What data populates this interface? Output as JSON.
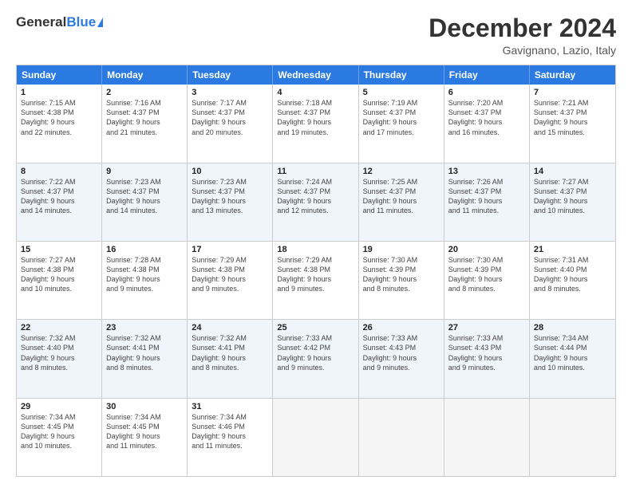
{
  "logo": {
    "general": "General",
    "blue": "Blue"
  },
  "header": {
    "month": "December 2024",
    "location": "Gavignano, Lazio, Italy"
  },
  "days": [
    "Sunday",
    "Monday",
    "Tuesday",
    "Wednesday",
    "Thursday",
    "Friday",
    "Saturday"
  ],
  "rows": [
    [
      {
        "day": "1",
        "lines": [
          "Sunrise: 7:15 AM",
          "Sunset: 4:38 PM",
          "Daylight: 9 hours",
          "and 22 minutes."
        ]
      },
      {
        "day": "2",
        "lines": [
          "Sunrise: 7:16 AM",
          "Sunset: 4:37 PM",
          "Daylight: 9 hours",
          "and 21 minutes."
        ]
      },
      {
        "day": "3",
        "lines": [
          "Sunrise: 7:17 AM",
          "Sunset: 4:37 PM",
          "Daylight: 9 hours",
          "and 20 minutes."
        ]
      },
      {
        "day": "4",
        "lines": [
          "Sunrise: 7:18 AM",
          "Sunset: 4:37 PM",
          "Daylight: 9 hours",
          "and 19 minutes."
        ]
      },
      {
        "day": "5",
        "lines": [
          "Sunrise: 7:19 AM",
          "Sunset: 4:37 PM",
          "Daylight: 9 hours",
          "and 17 minutes."
        ]
      },
      {
        "day": "6",
        "lines": [
          "Sunrise: 7:20 AM",
          "Sunset: 4:37 PM",
          "Daylight: 9 hours",
          "and 16 minutes."
        ]
      },
      {
        "day": "7",
        "lines": [
          "Sunrise: 7:21 AM",
          "Sunset: 4:37 PM",
          "Daylight: 9 hours",
          "and 15 minutes."
        ]
      }
    ],
    [
      {
        "day": "8",
        "lines": [
          "Sunrise: 7:22 AM",
          "Sunset: 4:37 PM",
          "Daylight: 9 hours",
          "and 14 minutes."
        ]
      },
      {
        "day": "9",
        "lines": [
          "Sunrise: 7:23 AM",
          "Sunset: 4:37 PM",
          "Daylight: 9 hours",
          "and 14 minutes."
        ]
      },
      {
        "day": "10",
        "lines": [
          "Sunrise: 7:23 AM",
          "Sunset: 4:37 PM",
          "Daylight: 9 hours",
          "and 13 minutes."
        ]
      },
      {
        "day": "11",
        "lines": [
          "Sunrise: 7:24 AM",
          "Sunset: 4:37 PM",
          "Daylight: 9 hours",
          "and 12 minutes."
        ]
      },
      {
        "day": "12",
        "lines": [
          "Sunrise: 7:25 AM",
          "Sunset: 4:37 PM",
          "Daylight: 9 hours",
          "and 11 minutes."
        ]
      },
      {
        "day": "13",
        "lines": [
          "Sunrise: 7:26 AM",
          "Sunset: 4:37 PM",
          "Daylight: 9 hours",
          "and 11 minutes."
        ]
      },
      {
        "day": "14",
        "lines": [
          "Sunrise: 7:27 AM",
          "Sunset: 4:37 PM",
          "Daylight: 9 hours",
          "and 10 minutes."
        ]
      }
    ],
    [
      {
        "day": "15",
        "lines": [
          "Sunrise: 7:27 AM",
          "Sunset: 4:38 PM",
          "Daylight: 9 hours",
          "and 10 minutes."
        ]
      },
      {
        "day": "16",
        "lines": [
          "Sunrise: 7:28 AM",
          "Sunset: 4:38 PM",
          "Daylight: 9 hours",
          "and 9 minutes."
        ]
      },
      {
        "day": "17",
        "lines": [
          "Sunrise: 7:29 AM",
          "Sunset: 4:38 PM",
          "Daylight: 9 hours",
          "and 9 minutes."
        ]
      },
      {
        "day": "18",
        "lines": [
          "Sunrise: 7:29 AM",
          "Sunset: 4:38 PM",
          "Daylight: 9 hours",
          "and 9 minutes."
        ]
      },
      {
        "day": "19",
        "lines": [
          "Sunrise: 7:30 AM",
          "Sunset: 4:39 PM",
          "Daylight: 9 hours",
          "and 8 minutes."
        ]
      },
      {
        "day": "20",
        "lines": [
          "Sunrise: 7:30 AM",
          "Sunset: 4:39 PM",
          "Daylight: 9 hours",
          "and 8 minutes."
        ]
      },
      {
        "day": "21",
        "lines": [
          "Sunrise: 7:31 AM",
          "Sunset: 4:40 PM",
          "Daylight: 9 hours",
          "and 8 minutes."
        ]
      }
    ],
    [
      {
        "day": "22",
        "lines": [
          "Sunrise: 7:32 AM",
          "Sunset: 4:40 PM",
          "Daylight: 9 hours",
          "and 8 minutes."
        ]
      },
      {
        "day": "23",
        "lines": [
          "Sunrise: 7:32 AM",
          "Sunset: 4:41 PM",
          "Daylight: 9 hours",
          "and 8 minutes."
        ]
      },
      {
        "day": "24",
        "lines": [
          "Sunrise: 7:32 AM",
          "Sunset: 4:41 PM",
          "Daylight: 9 hours",
          "and 8 minutes."
        ]
      },
      {
        "day": "25",
        "lines": [
          "Sunrise: 7:33 AM",
          "Sunset: 4:42 PM",
          "Daylight: 9 hours",
          "and 9 minutes."
        ]
      },
      {
        "day": "26",
        "lines": [
          "Sunrise: 7:33 AM",
          "Sunset: 4:43 PM",
          "Daylight: 9 hours",
          "and 9 minutes."
        ]
      },
      {
        "day": "27",
        "lines": [
          "Sunrise: 7:33 AM",
          "Sunset: 4:43 PM",
          "Daylight: 9 hours",
          "and 9 minutes."
        ]
      },
      {
        "day": "28",
        "lines": [
          "Sunrise: 7:34 AM",
          "Sunset: 4:44 PM",
          "Daylight: 9 hours",
          "and 10 minutes."
        ]
      }
    ],
    [
      {
        "day": "29",
        "lines": [
          "Sunrise: 7:34 AM",
          "Sunset: 4:45 PM",
          "Daylight: 9 hours",
          "and 10 minutes."
        ]
      },
      {
        "day": "30",
        "lines": [
          "Sunrise: 7:34 AM",
          "Sunset: 4:45 PM",
          "Daylight: 9 hours",
          "and 11 minutes."
        ]
      },
      {
        "day": "31",
        "lines": [
          "Sunrise: 7:34 AM",
          "Sunset: 4:46 PM",
          "Daylight: 9 hours",
          "and 11 minutes."
        ]
      },
      null,
      null,
      null,
      null
    ]
  ]
}
